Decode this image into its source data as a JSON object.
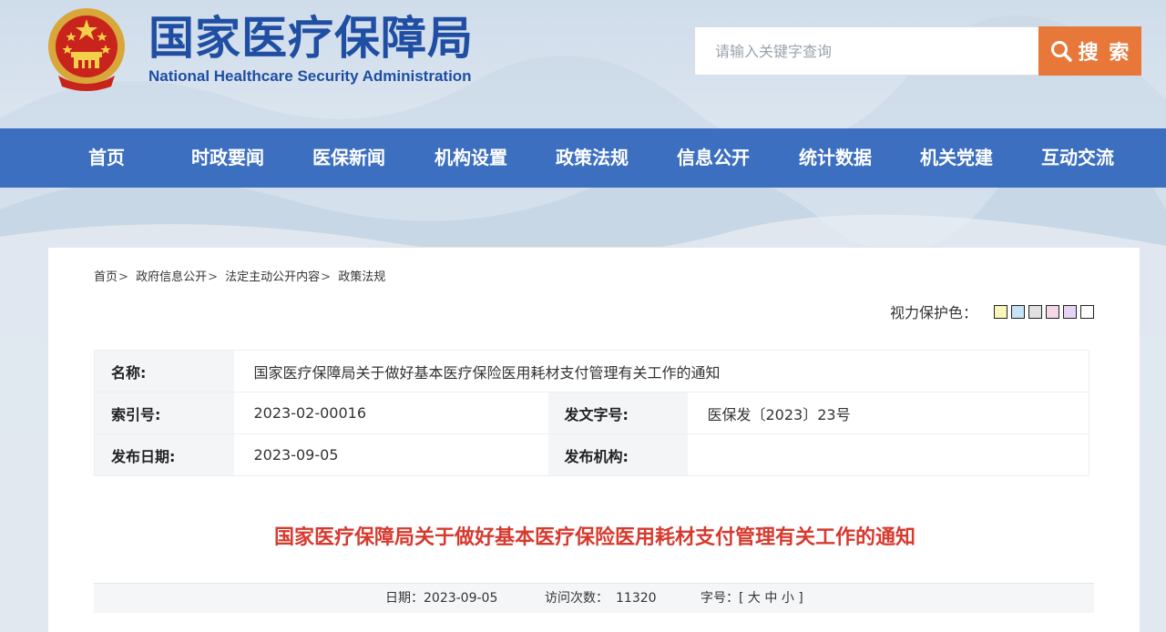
{
  "header": {
    "title": "国家医疗保障局",
    "subtitle": "National Healthcare Security Administration",
    "emblem_icon": "national-emblem-icon"
  },
  "search": {
    "placeholder": "请输入关键字查询",
    "button_label": "搜 索",
    "accent_color": "#e8783a"
  },
  "nav": {
    "background_color": "#3c6fc0",
    "items": [
      {
        "label": "首页"
      },
      {
        "label": "时政要闻"
      },
      {
        "label": "医保新闻"
      },
      {
        "label": "机构设置"
      },
      {
        "label": "政策法规"
      },
      {
        "label": "信息公开"
      },
      {
        "label": "统计数据"
      },
      {
        "label": "机关党建"
      },
      {
        "label": "互动交流"
      }
    ]
  },
  "breadcrumb": {
    "items": [
      "首页",
      "政府信息公开",
      "法定主动公开内容",
      "政策法规"
    ],
    "separator": ">"
  },
  "eye_care": {
    "label": "视力保护色：",
    "swatches": [
      "#faf5b9",
      "#c6e2f5",
      "#e1e1e1",
      "#f7d7e6",
      "#e6d4f5",
      "#ffffff"
    ]
  },
  "meta": {
    "name_label": "名称:",
    "name_value": "国家医疗保障局关于做好基本医疗保险医用耗材支付管理有关工作的通知",
    "index_label": "索引号:",
    "index_value": "2023-02-00016",
    "doc_no_label": "发文字号:",
    "doc_no_value": "医保发〔2023〕23号",
    "date_label": "发布日期:",
    "date_value": "2023-09-05",
    "org_label": "发布机构:",
    "org_value": ""
  },
  "document": {
    "title": "国家医疗保障局关于做好基本医疗保险医用耗材支付管理有关工作的通知",
    "title_color": "#d63a2f"
  },
  "info_bar": {
    "date_label": "日期：",
    "date_value": "2023-09-05",
    "views_label": "访问次数：",
    "views_value": "11320",
    "font_label": "字号：",
    "font_open": "[",
    "font_large": "大",
    "font_medium": "中",
    "font_small": "小",
    "font_close": "]"
  }
}
